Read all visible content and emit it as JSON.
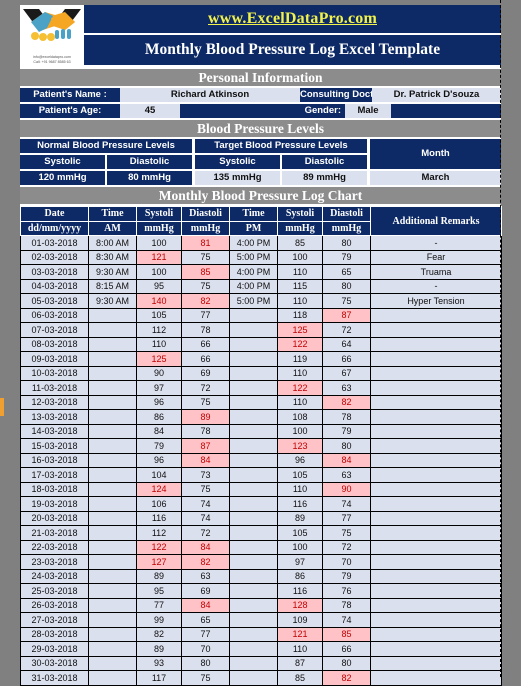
{
  "header": {
    "url": "www.ExcelDataPro.com",
    "title": "Monthly Blood Pressure Log Excel Template",
    "logo_email": "info@exceldatapro.com",
    "logo_phone": "Call: +91 9687 8585 63"
  },
  "personal_information": {
    "section_title": "Personal Information",
    "name_label": "Patient's Name :",
    "name_value": "Richard Atkinson",
    "doctor_label": "Consulting Doctor:",
    "doctor_value": "Dr. Patrick D'souza",
    "age_label": "Patient's Age:",
    "age_value": "45",
    "gender_label": "Gender:",
    "gender_value": "Male"
  },
  "bp_levels": {
    "section_title": "Blood Pressure Levels",
    "normal_header": "Normal Blood Pressure Levels",
    "target_header": "Target Blood Pressure Levels",
    "month_header": "Month",
    "systolic_label": "Systolic",
    "diastolic_label": "Diastolic",
    "normal_systolic": "120 mmHg",
    "normal_diastolic": "80 mmHg",
    "target_systolic": "135 mmHg",
    "target_diastolic": "89 mmHg",
    "month_value": "March"
  },
  "log": {
    "section_title": "Monthly Blood Pressure Log Chart",
    "headers": {
      "date": "Date",
      "date_sub": "dd/mm/yyyy",
      "time_am": "Time",
      "time_am_sub": "AM",
      "systolic_am": "Systoli",
      "systolic_am_sub": "mmHg",
      "diastolic_am": "Diastoli",
      "diastolic_am_sub": "mmHg",
      "time_pm": "Time",
      "time_pm_sub": "PM",
      "systolic_pm": "Systoli",
      "systolic_pm_sub": "mmHg",
      "diastolic_pm": "Diastoli",
      "diastolic_pm_sub": "mmHg",
      "remarks": "Additional Remarks"
    },
    "rows": [
      {
        "date": "01-03-2018",
        "am_time": "8:00 AM",
        "am_sys": "100",
        "am_sys_hl": false,
        "am_dia": "81",
        "am_dia_hl": true,
        "pm_time": "4:00 PM",
        "pm_sys": "85",
        "pm_sys_hl": false,
        "pm_dia": "80",
        "pm_dia_hl": false,
        "remarks": "-"
      },
      {
        "date": "02-03-2018",
        "am_time": "8:30 AM",
        "am_sys": "121",
        "am_sys_hl": true,
        "am_dia": "75",
        "am_dia_hl": false,
        "pm_time": "5:00 PM",
        "pm_sys": "100",
        "pm_sys_hl": false,
        "pm_dia": "79",
        "pm_dia_hl": false,
        "remarks": "Fear"
      },
      {
        "date": "03-03-2018",
        "am_time": "9:30 AM",
        "am_sys": "100",
        "am_sys_hl": false,
        "am_dia": "85",
        "am_dia_hl": true,
        "pm_time": "4:00 PM",
        "pm_sys": "110",
        "pm_sys_hl": false,
        "pm_dia": "65",
        "pm_dia_hl": false,
        "remarks": "Truama"
      },
      {
        "date": "04-03-2018",
        "am_time": "8:15 AM",
        "am_sys": "95",
        "am_sys_hl": false,
        "am_dia": "75",
        "am_dia_hl": false,
        "pm_time": "4:00 PM",
        "pm_sys": "115",
        "pm_sys_hl": false,
        "pm_dia": "80",
        "pm_dia_hl": false,
        "remarks": "-"
      },
      {
        "date": "05-03-2018",
        "am_time": "9:30 AM",
        "am_sys": "140",
        "am_sys_hl": true,
        "am_dia": "82",
        "am_dia_hl": true,
        "pm_time": "5:00 PM",
        "pm_sys": "110",
        "pm_sys_hl": false,
        "pm_dia": "75",
        "pm_dia_hl": false,
        "remarks": "Hyper Tension"
      },
      {
        "date": "06-03-2018",
        "am_time": "",
        "am_sys": "105",
        "am_sys_hl": false,
        "am_dia": "77",
        "am_dia_hl": false,
        "pm_time": "",
        "pm_sys": "118",
        "pm_sys_hl": false,
        "pm_dia": "87",
        "pm_dia_hl": true,
        "remarks": ""
      },
      {
        "date": "07-03-2018",
        "am_time": "",
        "am_sys": "112",
        "am_sys_hl": false,
        "am_dia": "78",
        "am_dia_hl": false,
        "pm_time": "",
        "pm_sys": "125",
        "pm_sys_hl": true,
        "pm_dia": "72",
        "pm_dia_hl": false,
        "remarks": ""
      },
      {
        "date": "08-03-2018",
        "am_time": "",
        "am_sys": "110",
        "am_sys_hl": false,
        "am_dia": "66",
        "am_dia_hl": false,
        "pm_time": "",
        "pm_sys": "122",
        "pm_sys_hl": true,
        "pm_dia": "64",
        "pm_dia_hl": false,
        "remarks": ""
      },
      {
        "date": "09-03-2018",
        "am_time": "",
        "am_sys": "125",
        "am_sys_hl": true,
        "am_dia": "66",
        "am_dia_hl": false,
        "pm_time": "",
        "pm_sys": "119",
        "pm_sys_hl": false,
        "pm_dia": "66",
        "pm_dia_hl": false,
        "remarks": ""
      },
      {
        "date": "10-03-2018",
        "am_time": "",
        "am_sys": "90",
        "am_sys_hl": false,
        "am_dia": "69",
        "am_dia_hl": false,
        "pm_time": "",
        "pm_sys": "110",
        "pm_sys_hl": false,
        "pm_dia": "67",
        "pm_dia_hl": false,
        "remarks": ""
      },
      {
        "date": "11-03-2018",
        "am_time": "",
        "am_sys": "97",
        "am_sys_hl": false,
        "am_dia": "72",
        "am_dia_hl": false,
        "pm_time": "",
        "pm_sys": "122",
        "pm_sys_hl": true,
        "pm_dia": "63",
        "pm_dia_hl": false,
        "remarks": ""
      },
      {
        "date": "12-03-2018",
        "am_time": "",
        "am_sys": "96",
        "am_sys_hl": false,
        "am_dia": "75",
        "am_dia_hl": false,
        "pm_time": "",
        "pm_sys": "110",
        "pm_sys_hl": false,
        "pm_dia": "82",
        "pm_dia_hl": true,
        "remarks": ""
      },
      {
        "date": "13-03-2018",
        "am_time": "",
        "am_sys": "86",
        "am_sys_hl": false,
        "am_dia": "89",
        "am_dia_hl": true,
        "pm_time": "",
        "pm_sys": "108",
        "pm_sys_hl": false,
        "pm_dia": "78",
        "pm_dia_hl": false,
        "remarks": ""
      },
      {
        "date": "14-03-2018",
        "am_time": "",
        "am_sys": "84",
        "am_sys_hl": false,
        "am_dia": "78",
        "am_dia_hl": false,
        "pm_time": "",
        "pm_sys": "100",
        "pm_sys_hl": false,
        "pm_dia": "79",
        "pm_dia_hl": false,
        "remarks": ""
      },
      {
        "date": "15-03-2018",
        "am_time": "",
        "am_sys": "79",
        "am_sys_hl": false,
        "am_dia": "87",
        "am_dia_hl": true,
        "pm_time": "",
        "pm_sys": "123",
        "pm_sys_hl": true,
        "pm_dia": "80",
        "pm_dia_hl": false,
        "remarks": ""
      },
      {
        "date": "16-03-2018",
        "am_time": "",
        "am_sys": "96",
        "am_sys_hl": false,
        "am_dia": "84",
        "am_dia_hl": true,
        "pm_time": "",
        "pm_sys": "96",
        "pm_sys_hl": false,
        "pm_dia": "84",
        "pm_dia_hl": true,
        "remarks": ""
      },
      {
        "date": "17-03-2018",
        "am_time": "",
        "am_sys": "104",
        "am_sys_hl": false,
        "am_dia": "73",
        "am_dia_hl": false,
        "pm_time": "",
        "pm_sys": "105",
        "pm_sys_hl": false,
        "pm_dia": "63",
        "pm_dia_hl": false,
        "remarks": ""
      },
      {
        "date": "18-03-2018",
        "am_time": "",
        "am_sys": "124",
        "am_sys_hl": true,
        "am_dia": "75",
        "am_dia_hl": false,
        "pm_time": "",
        "pm_sys": "110",
        "pm_sys_hl": false,
        "pm_dia": "90",
        "pm_dia_hl": true,
        "remarks": ""
      },
      {
        "date": "19-03-2018",
        "am_time": "",
        "am_sys": "106",
        "am_sys_hl": false,
        "am_dia": "74",
        "am_dia_hl": false,
        "pm_time": "",
        "pm_sys": "116",
        "pm_sys_hl": false,
        "pm_dia": "74",
        "pm_dia_hl": false,
        "remarks": ""
      },
      {
        "date": "20-03-2018",
        "am_time": "",
        "am_sys": "116",
        "am_sys_hl": false,
        "am_dia": "74",
        "am_dia_hl": false,
        "pm_time": "",
        "pm_sys": "89",
        "pm_sys_hl": false,
        "pm_dia": "77",
        "pm_dia_hl": false,
        "remarks": ""
      },
      {
        "date": "21-03-2018",
        "am_time": "",
        "am_sys": "112",
        "am_sys_hl": false,
        "am_dia": "72",
        "am_dia_hl": false,
        "pm_time": "",
        "pm_sys": "105",
        "pm_sys_hl": false,
        "pm_dia": "75",
        "pm_dia_hl": false,
        "remarks": ""
      },
      {
        "date": "22-03-2018",
        "am_time": "",
        "am_sys": "122",
        "am_sys_hl": true,
        "am_dia": "84",
        "am_dia_hl": true,
        "pm_time": "",
        "pm_sys": "100",
        "pm_sys_hl": false,
        "pm_dia": "72",
        "pm_dia_hl": false,
        "remarks": ""
      },
      {
        "date": "23-03-2018",
        "am_time": "",
        "am_sys": "127",
        "am_sys_hl": true,
        "am_dia": "82",
        "am_dia_hl": true,
        "pm_time": "",
        "pm_sys": "97",
        "pm_sys_hl": false,
        "pm_dia": "70",
        "pm_dia_hl": false,
        "remarks": ""
      },
      {
        "date": "24-03-2018",
        "am_time": "",
        "am_sys": "89",
        "am_sys_hl": false,
        "am_dia": "63",
        "am_dia_hl": false,
        "pm_time": "",
        "pm_sys": "86",
        "pm_sys_hl": false,
        "pm_dia": "79",
        "pm_dia_hl": false,
        "remarks": ""
      },
      {
        "date": "25-03-2018",
        "am_time": "",
        "am_sys": "95",
        "am_sys_hl": false,
        "am_dia": "69",
        "am_dia_hl": false,
        "pm_time": "",
        "pm_sys": "116",
        "pm_sys_hl": false,
        "pm_dia": "76",
        "pm_dia_hl": false,
        "remarks": ""
      },
      {
        "date": "26-03-2018",
        "am_time": "",
        "am_sys": "77",
        "am_sys_hl": false,
        "am_dia": "84",
        "am_dia_hl": true,
        "pm_time": "",
        "pm_sys": "128",
        "pm_sys_hl": true,
        "pm_dia": "78",
        "pm_dia_hl": false,
        "remarks": ""
      },
      {
        "date": "27-03-2018",
        "am_time": "",
        "am_sys": "99",
        "am_sys_hl": false,
        "am_dia": "65",
        "am_dia_hl": false,
        "pm_time": "",
        "pm_sys": "109",
        "pm_sys_hl": false,
        "pm_dia": "74",
        "pm_dia_hl": false,
        "remarks": ""
      },
      {
        "date": "28-03-2018",
        "am_time": "",
        "am_sys": "82",
        "am_sys_hl": false,
        "am_dia": "77",
        "am_dia_hl": false,
        "pm_time": "",
        "pm_sys": "121",
        "pm_sys_hl": true,
        "pm_dia": "85",
        "pm_dia_hl": true,
        "remarks": ""
      },
      {
        "date": "29-03-2018",
        "am_time": "",
        "am_sys": "89",
        "am_sys_hl": false,
        "am_dia": "70",
        "am_dia_hl": false,
        "pm_time": "",
        "pm_sys": "110",
        "pm_sys_hl": false,
        "pm_dia": "66",
        "pm_dia_hl": false,
        "remarks": ""
      },
      {
        "date": "30-03-2018",
        "am_time": "",
        "am_sys": "93",
        "am_sys_hl": false,
        "am_dia": "80",
        "am_dia_hl": false,
        "pm_time": "",
        "pm_sys": "87",
        "pm_sys_hl": false,
        "pm_dia": "80",
        "pm_dia_hl": false,
        "remarks": ""
      },
      {
        "date": "31-03-2018",
        "am_time": "",
        "am_sys": "117",
        "am_sys_hl": false,
        "am_dia": "75",
        "am_dia_hl": false,
        "pm_time": "",
        "pm_sys": "85",
        "pm_sys_hl": false,
        "pm_dia": "82",
        "pm_dia_hl": true,
        "remarks": ""
      }
    ]
  },
  "colors": {
    "navy": "#0d2a66",
    "gray_band": "#8c8c8c",
    "cell_light": "#dbe0ee",
    "highlight_bg": "#ffc3c7",
    "highlight_text": "#c00000",
    "url_yellow": "#f2f24d"
  }
}
